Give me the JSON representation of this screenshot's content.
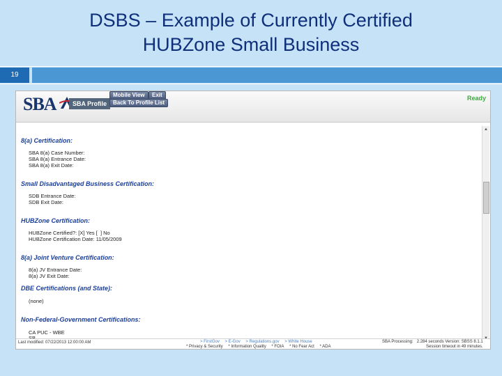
{
  "slide": {
    "title_line1": "DSBS – Example of Currently Certified",
    "title_line2": "HUBZone Small Business",
    "number": "19"
  },
  "app": {
    "logo": "SBA",
    "profile_label": "SBA Profile",
    "buttons": {
      "mobile_view": "Mobile View",
      "exit": "Exit",
      "back_to_profile_list": "Back To Profile List"
    },
    "status": "Ready"
  },
  "sections": [
    {
      "title": "8(a) Certification:",
      "lines": [
        "SBA 8(a) Case Number:",
        "SBA 8(a) Entrance Date:",
        "SBA 8(a) Exit Date:"
      ]
    },
    {
      "title": "Small Disadvantaged Business Certification:",
      "lines": [
        "SDB Entrance Date:",
        "SDB Exit Date:"
      ]
    },
    {
      "title": "HUBZone Certification:",
      "lines": [
        "HUBZone Certified?: [X] Yes [  ] No",
        "HUBZone Certification Date: 11/05/2009"
      ]
    },
    {
      "title": "8(a) Joint Venture Certification:",
      "lines": [
        "8(a) JV Entrance Date:",
        "8(a) JV Exit Date:"
      ]
    },
    {
      "title": "DBE Certifications (and State):",
      "lines": [
        "(none)"
      ]
    },
    {
      "title": "Non-Federal-Government Certifications:",
      "lines": [
        "CA PUC - WBE",
        "SB"
      ]
    }
  ],
  "footer": {
    "last_modified": "Last modified: 07/22/2013 12:00:00 AM",
    "links": [
      "> FirstGov",
      "> E-Gov",
      "> Regulations.gov",
      "> White House"
    ],
    "links2": [
      "* Privacy & Security",
      "* Information Quality",
      "* FOIA",
      "* No Fear Act",
      "* ADA"
    ],
    "processing": "SBA Processing:   2.284 seconds Version: SBSS 8.1.1",
    "timeout": "Session timeout in 49 minutes."
  },
  "colors": {
    "slide_background": "#c5e2f6",
    "title_color": "#0f2f7a",
    "section_title_color": "#1b3f9a",
    "ready_color": "#3cab3c",
    "link_color": "#4a7fc0"
  },
  "icons": {
    "scroll_up": "▲",
    "scroll_down": "▼"
  }
}
